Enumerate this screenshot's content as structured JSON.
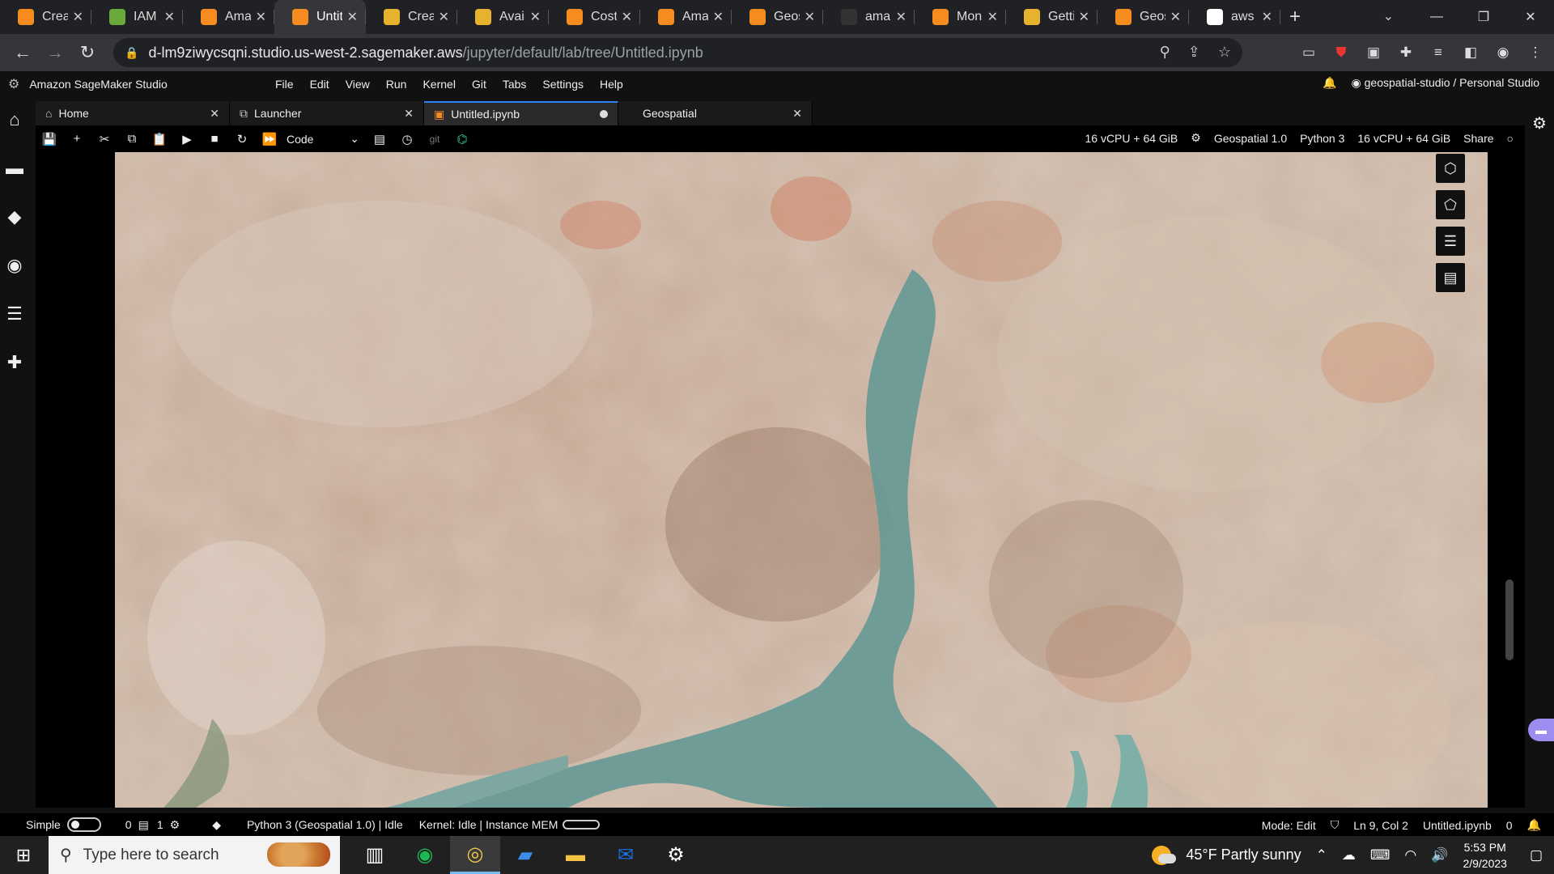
{
  "browser": {
    "tabs": [
      {
        "title": "Creat",
        "fav": "#f68c1f"
      },
      {
        "title": "IAM",
        "fav": "#6aaa3a"
      },
      {
        "title": "Ama",
        "fav": "#f68c1f"
      },
      {
        "title": "Untit",
        "fav": "#f68c1f",
        "active": true
      },
      {
        "title": "Creat",
        "fav": "#e7b22d"
      },
      {
        "title": "Avail",
        "fav": "#e7b22d"
      },
      {
        "title": "Cost",
        "fav": "#f68c1f"
      },
      {
        "title": "Ama",
        "fav": "#f68c1f"
      },
      {
        "title": "Geos",
        "fav": "#f68c1f"
      },
      {
        "title": "ama",
        "fav": "#333333"
      },
      {
        "title": "Mon",
        "fav": "#f68c1f"
      },
      {
        "title": "Getti",
        "fav": "#e7b22d"
      },
      {
        "title": "Geos",
        "fav": "#f68c1f"
      },
      {
        "title": "aws",
        "fav": "#ffffff"
      }
    ],
    "url_host": "d-lm9ziwycsqni.studio.us-west-2.sagemaker.aws",
    "url_path": "/jupyter/default/lab/tree/Untitled.ipynb"
  },
  "studio": {
    "title": "Amazon SageMaker Studio",
    "menu": [
      "File",
      "Edit",
      "View",
      "Run",
      "Kernel",
      "Git",
      "Tabs",
      "Settings",
      "Help"
    ],
    "user": "geospatial-studio / Personal Studio"
  },
  "doctabs": {
    "home": "Home",
    "launcher": "Launcher",
    "notebook": "Untitled.ipynb",
    "geospatial": "Geospatial"
  },
  "toolbar": {
    "cell_type": "Code",
    "git": "git",
    "instance1": "16 vCPU + 64 GiB",
    "image": "Geospatial 1.0",
    "kernel": "Python 3",
    "instance2": "16 vCPU + 64 GiB",
    "share": "Share"
  },
  "status": {
    "mode_label": "Simple",
    "count1": "0",
    "count2": "1",
    "kernel_info": "Python 3 (Geospatial 1.0) | Idle",
    "kernel_state": "Kernel: Idle | Instance MEM",
    "mode": "Mode: Edit",
    "position": "Ln 9, Col 2",
    "file": "Untitled.ipynb",
    "notifications": "0"
  },
  "taskbar": {
    "search_placeholder": "Type here to search",
    "weather": "45°F  Partly sunny",
    "time": "5:53 PM",
    "date": "2/9/2023"
  },
  "icons": {
    "map_tools": [
      "cube-icon",
      "draw-polygon-icon",
      "layers-list-icon",
      "legend-icon"
    ]
  },
  "colors": {
    "accent": "#2f81f7",
    "water": "#6a9a96",
    "desert": "#cdb29b"
  }
}
